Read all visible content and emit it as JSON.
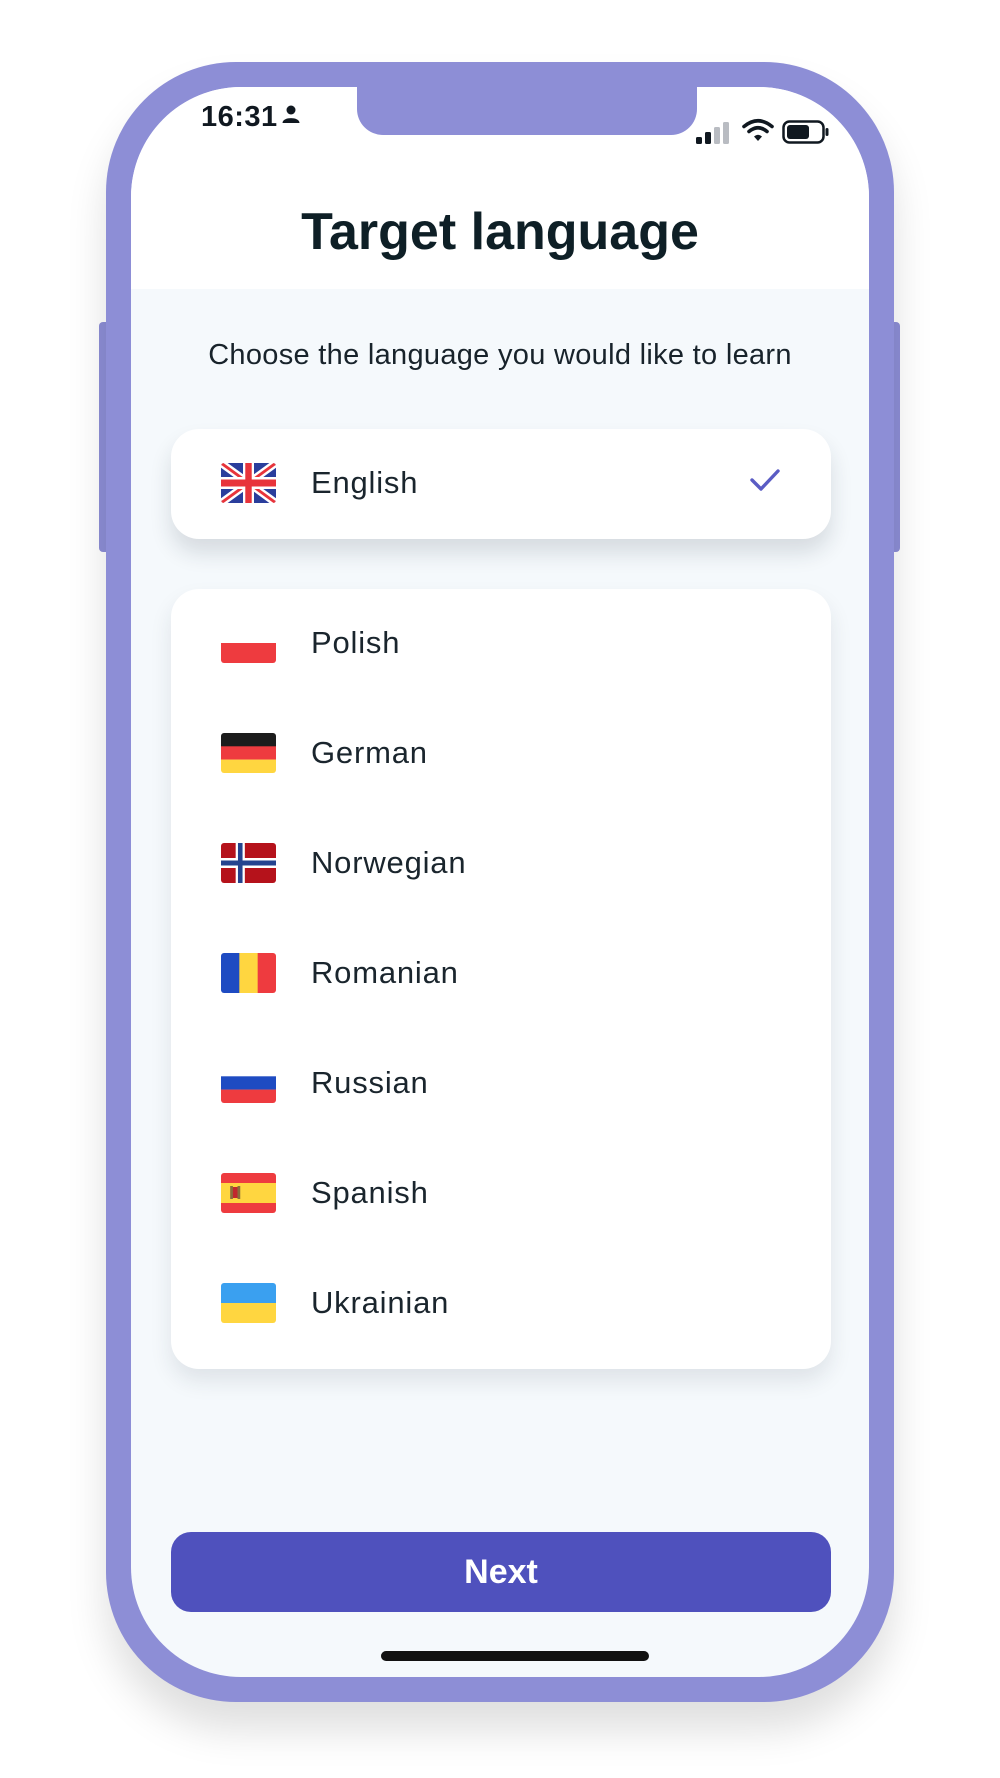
{
  "status_bar": {
    "time": "16:31",
    "icons": [
      "person-icon",
      "signal-icon",
      "wifi-icon",
      "battery-icon"
    ]
  },
  "header": {
    "title": "Target language"
  },
  "main": {
    "subtitle": "Choose the language you would like to learn",
    "selected": {
      "label": "English",
      "flag": "uk-flag",
      "icon": "check-icon"
    },
    "languages": [
      {
        "label": "Polish",
        "flag": "poland-flag"
      },
      {
        "label": "German",
        "flag": "germany-flag"
      },
      {
        "label": "Norwegian",
        "flag": "norway-flag"
      },
      {
        "label": "Romanian",
        "flag": "romania-flag"
      },
      {
        "label": "Russian",
        "flag": "russia-flag"
      },
      {
        "label": "Spanish",
        "flag": "spain-flag"
      },
      {
        "label": "Ukrainian",
        "flag": "ukraine-flag"
      }
    ]
  },
  "footer": {
    "next_label": "Next"
  },
  "colors": {
    "frame": "#8d8ed6",
    "accent": "#4f51bd",
    "check": "#5a5cc4",
    "background": "#f5f9fc",
    "text": "#0e1f26"
  }
}
